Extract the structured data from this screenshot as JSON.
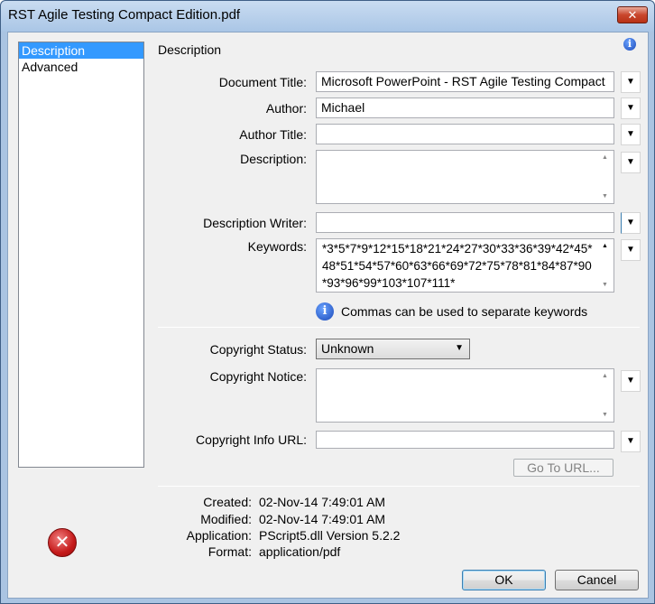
{
  "window": {
    "title": "RST Agile Testing Compact Edition.pdf"
  },
  "nav": [
    {
      "label": "Description"
    },
    {
      "label": "Advanced"
    }
  ],
  "section_title": "Description",
  "fields": {
    "document_title": {
      "label": "Document Title:",
      "value": "Microsoft PowerPoint - RST Agile Testing Compact"
    },
    "author": {
      "label": "Author:",
      "value": "Michael"
    },
    "author_title": {
      "label": "Author Title:",
      "value": ""
    },
    "description": {
      "label": "Description:",
      "value": ""
    },
    "description_writer": {
      "label": "Description Writer:",
      "value": ""
    },
    "keywords": {
      "label": "Keywords:",
      "value": "*3*5*7*9*12*15*18*21*24*27*30*33*36*39*42*45*48*51*54*57*60*63*66*69*72*75*78*81*84*87*90*93*96*99*103*107*111*"
    },
    "keywords_hint": "Commas can be used to separate keywords",
    "copyright_status": {
      "label": "Copyright Status:",
      "value": "Unknown"
    },
    "copyright_notice": {
      "label": "Copyright Notice:",
      "value": ""
    },
    "copyright_url": {
      "label": "Copyright Info URL:",
      "value": ""
    }
  },
  "goto_button": "Go To URL...",
  "meta": {
    "created": {
      "label": "Created:",
      "value": "02-Nov-14 7:49:01 AM"
    },
    "modified": {
      "label": "Modified:",
      "value": "02-Nov-14 7:49:01 AM"
    },
    "application": {
      "label": "Application:",
      "value": "PScript5.dll Version 5.2.2"
    },
    "format": {
      "label": "Format:",
      "value": "application/pdf"
    }
  },
  "buttons": {
    "ok": "OK",
    "cancel": "Cancel"
  },
  "icons": {
    "close": "close-icon",
    "info": "info-icon",
    "error": "error-icon",
    "dropdown": "chevron-down-icon"
  },
  "colors": {
    "selection": "#3399ff",
    "titlebar": "#aac6e6",
    "close": "#c9462c"
  }
}
